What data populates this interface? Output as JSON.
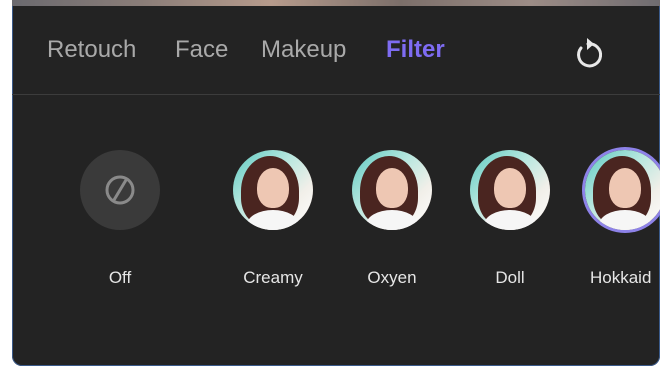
{
  "tabs": [
    {
      "label": "Retouch",
      "active": false
    },
    {
      "label": "Face",
      "active": false
    },
    {
      "label": "Makeup",
      "active": false
    },
    {
      "label": "Filter",
      "active": true
    }
  ],
  "reset_icon": "reset-icon",
  "filters": [
    {
      "label": "Off",
      "icon": "none-icon",
      "selected": false
    },
    {
      "label": "Creamy",
      "selected": false
    },
    {
      "label": "Oxyen",
      "selected": false
    },
    {
      "label": "Doll",
      "selected": false
    },
    {
      "label": "Hokkaid",
      "selected": true
    }
  ],
  "colors": {
    "panel_bg": "#232323",
    "accent": "#7e6cf2",
    "tab_inactive": "#a9a9a9",
    "label": "#e6e6e6"
  }
}
